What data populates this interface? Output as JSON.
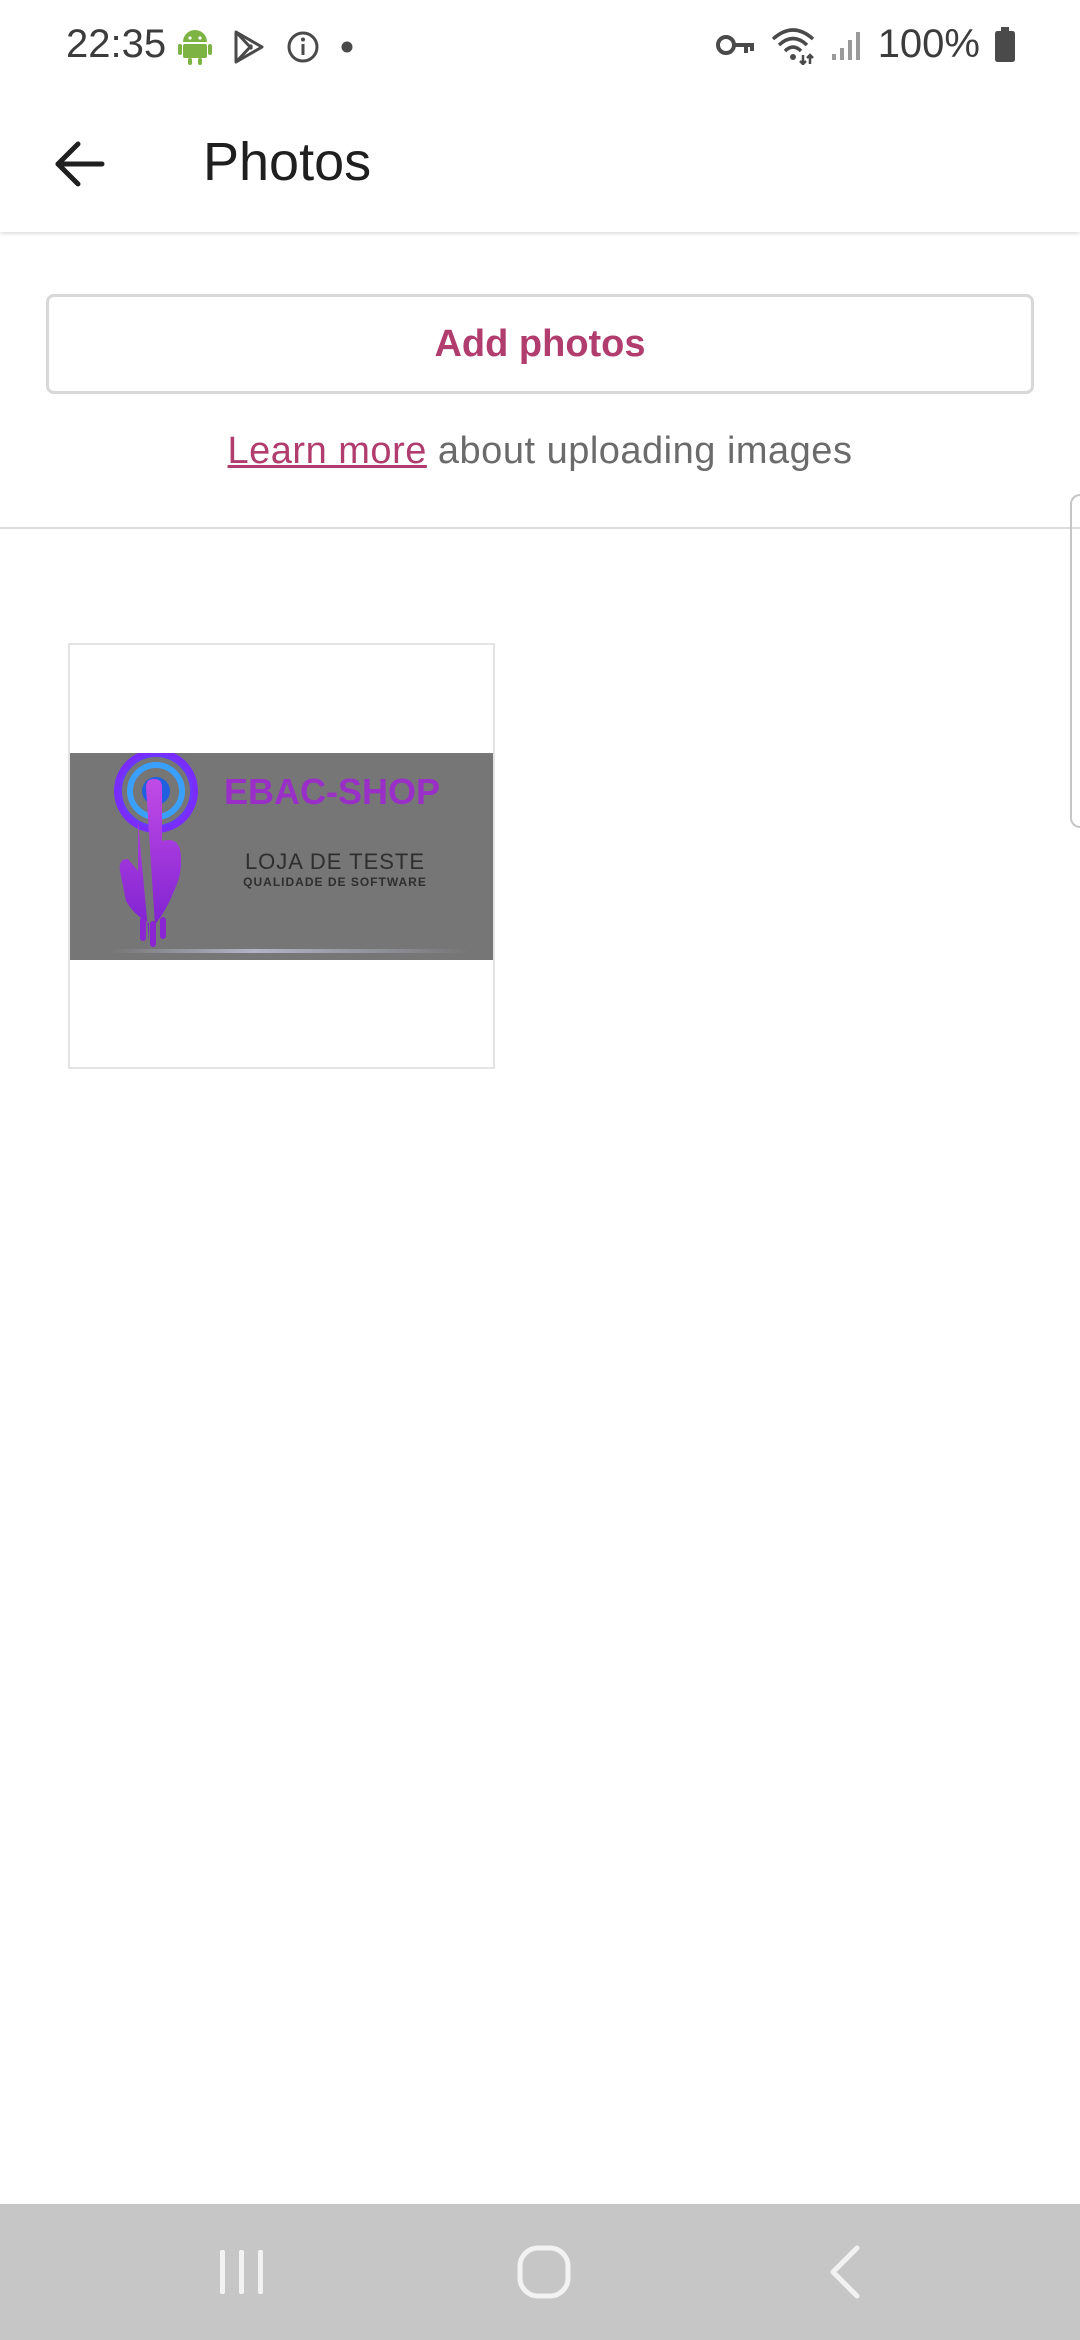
{
  "status_bar": {
    "time": "22:35",
    "battery_percent": "100%",
    "left_icons": [
      "android-icon",
      "play-store-icon",
      "info-icon",
      "dot-icon"
    ],
    "right_icons": [
      "vpn-key-icon",
      "wifi-icon",
      "cell-signal-icon",
      "battery-icon"
    ]
  },
  "app_bar": {
    "title": "Photos",
    "back_icon": "arrow-back-icon"
  },
  "add_photos": {
    "button_label": "Add photos",
    "learn_more_link": "Learn more",
    "learn_more_rest": " about uploading images"
  },
  "photos": [
    {
      "brand_text": "EBAC-SHOP",
      "tagline": "LOJA DE TESTE",
      "subtagline": "QUALIDADE DE SOFTWARE"
    }
  ],
  "nav_bar": {
    "icons": [
      "recent-apps-icon",
      "home-icon",
      "nav-back-icon"
    ]
  },
  "colors": {
    "accent": "#b13c6e",
    "text_primary": "#1f1f1f",
    "text_secondary": "#6b6b6b",
    "nav_bar_bg": "#c6c6c6",
    "photo_bg": "#767676",
    "brand_purple": "#9a2fc7"
  }
}
